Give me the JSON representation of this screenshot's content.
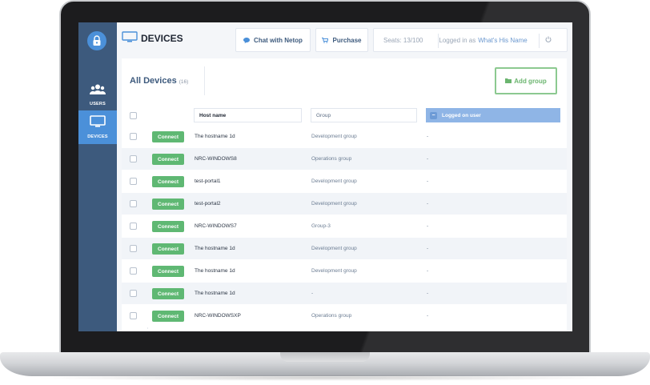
{
  "header": {
    "title": "DEVICES",
    "chat_label": "Chat with Netop",
    "purchase_label": "Purchase",
    "seats": "Seats: 13/100",
    "logged_in_prefix": "Logged in as",
    "user_name": "What's His Name"
  },
  "sidebar": {
    "items": [
      {
        "label": "USERS",
        "icon": "users-icon"
      },
      {
        "label": "DEVICES",
        "icon": "monitor-icon"
      }
    ]
  },
  "main": {
    "heading": "All Devices",
    "count": "(16)",
    "add_group_label": "Add group"
  },
  "table": {
    "columns": [
      "Host name",
      "Group",
      "Logged on user"
    ],
    "connect_label": "Connect",
    "rows": [
      {
        "host": "The hostname 1d",
        "group": "Development group",
        "user": "-"
      },
      {
        "host": "NRC-WINDOWS8",
        "group": "Operations group",
        "user": "-"
      },
      {
        "host": "test-portal1",
        "group": "Development group",
        "user": "-"
      },
      {
        "host": "test-portal2",
        "group": "Development group",
        "user": "-"
      },
      {
        "host": "NRC-WINDOWS7",
        "group": "Group-3",
        "user": "-"
      },
      {
        "host": "The hostname 1d",
        "group": "Development group",
        "user": "-"
      },
      {
        "host": "The hostname 1d",
        "group": "Development group",
        "user": "-"
      },
      {
        "host": "The hostname 1d",
        "group": "-",
        "user": "-"
      },
      {
        "host": "NRC-WINDOWSXP",
        "group": "Operations group",
        "user": "-"
      }
    ]
  },
  "colors": {
    "sidebar": "#3d5a7d",
    "accent_blue": "#4b90d9",
    "connect_green": "#5fb873",
    "add_group_green": "#8cc990"
  }
}
